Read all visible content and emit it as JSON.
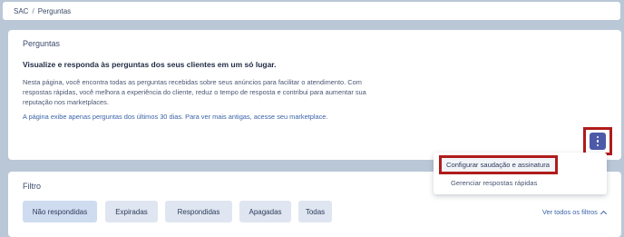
{
  "breadcrumb": {
    "root": "SAC",
    "separator": "/",
    "current": "Perguntas"
  },
  "card": {
    "title": "Perguntas",
    "headline": "Visualize e responda às perguntas dos seus clientes em um só lugar.",
    "description": "Nesta página, você encontra todas as perguntas recebidas sobre seus anúncios para facilitar o atendimento. Com respostas rápidas, você melhora a experiência do cliente, reduz o tempo de resposta e contribui para aumentar sua reputação nos marketplaces.",
    "note": "A página exibe apenas perguntas dos últimos 30 dias. Para ver mais antigas, acesse seu marketplace."
  },
  "menu": {
    "items": [
      {
        "label": "Configurar saudação e assinatura"
      },
      {
        "label": "Gerenciar respostas rápidas"
      }
    ]
  },
  "filter": {
    "title": "Filtro",
    "chips": [
      {
        "label": "Não respondidas"
      },
      {
        "label": "Expiradas"
      },
      {
        "label": "Respondidas"
      },
      {
        "label": "Apagadas"
      },
      {
        "label": "Todas"
      }
    ],
    "see_all": "Ver todos os filtros"
  },
  "colors": {
    "accent": "#4c5aa8",
    "highlight_border": "#b01c1c",
    "link": "#3c63a8",
    "background": "#b9c7d6"
  },
  "icons": {
    "menu_button": "kebab-icon",
    "see_all": "chevron-up-icon"
  }
}
